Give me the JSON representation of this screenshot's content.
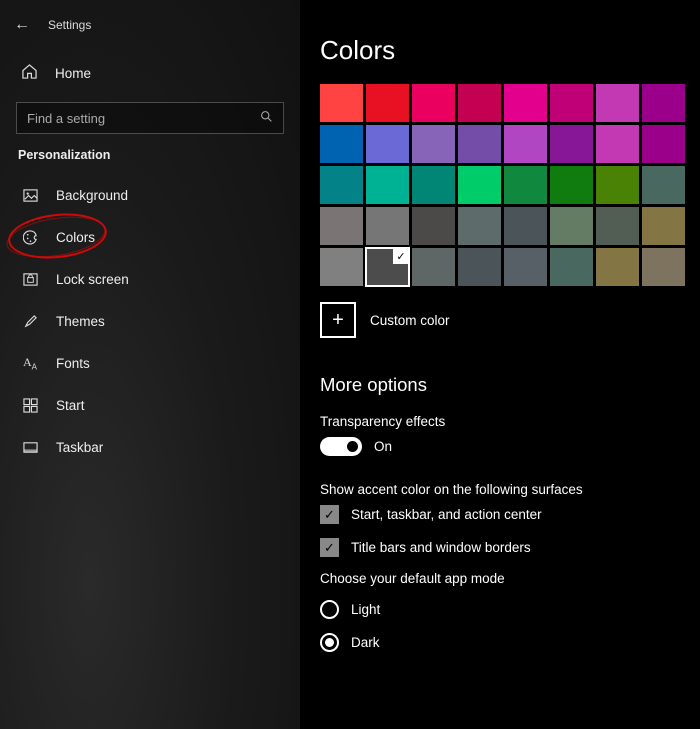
{
  "app_title": "Settings",
  "home_label": "Home",
  "search_placeholder": "Find a setting",
  "section_label": "Personalization",
  "nav": [
    {
      "label": "Background",
      "icon": "image-icon"
    },
    {
      "label": "Colors",
      "icon": "palette-icon",
      "circled": true
    },
    {
      "label": "Lock screen",
      "icon": "lock-icon"
    },
    {
      "label": "Themes",
      "icon": "brush-icon"
    },
    {
      "label": "Fonts",
      "icon": "fonts-icon"
    },
    {
      "label": "Start",
      "icon": "start-icon"
    },
    {
      "label": "Taskbar",
      "icon": "taskbar-icon"
    }
  ],
  "page_title": "Colors",
  "swatches": [
    [
      "#ff4343",
      "#e81123",
      "#ea005e",
      "#c30052",
      "#e3008c",
      "#bf0077",
      "#c239b3",
      "#9a0089"
    ],
    [
      "#0063b1",
      "#6b69d6",
      "#8764b8",
      "#744da9",
      "#b146c2",
      "#881798",
      "#c239b3",
      "#9a0089"
    ],
    [
      "#038387",
      "#00b294",
      "#018574",
      "#00cc6a",
      "#10893e",
      "#107c10",
      "#498205",
      "#486860"
    ],
    [
      "#7a7574",
      "#767676",
      "#4c4a48",
      "#5d6b6b",
      "#4a5459",
      "#647c64",
      "#525e54",
      "#847545"
    ],
    [
      "#808080",
      "#4c4c4c",
      "#5e6666",
      "#4a5459",
      "#566066",
      "#486860",
      "#847545",
      "#7e735f"
    ]
  ],
  "selected_swatch": {
    "row": 4,
    "col": 1
  },
  "custom_color_label": "Custom color",
  "more_options_title": "More options",
  "transparency": {
    "label": "Transparency effects",
    "state": "On"
  },
  "accent_surfaces": {
    "label": "Show accent color on the following surfaces",
    "options": [
      {
        "label": "Start, taskbar, and action center",
        "checked": true
      },
      {
        "label": "Title bars and window borders",
        "checked": true
      }
    ]
  },
  "app_mode": {
    "label": "Choose your default app mode",
    "options": [
      {
        "label": "Light",
        "selected": false
      },
      {
        "label": "Dark",
        "selected": true
      }
    ]
  }
}
